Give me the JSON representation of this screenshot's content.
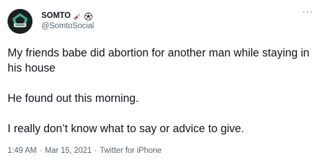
{
  "tweet": {
    "author": {
      "display_name": "SOMTO",
      "handle": "@SomtoSocial",
      "name_emojis": [
        "syringe-emoji",
        "soccer-ball-emoji"
      ]
    },
    "more_icon": "more-horizontal-icon",
    "body": [
      "My friends babe did abortion for another man while staying in his house",
      "He found out this morning.",
      "I really don’t know what to say or advice to give."
    ],
    "meta": {
      "time": "1:49 AM",
      "separator": "·",
      "date": "Mar 15, 2021",
      "source": "Twitter for iPhone"
    }
  },
  "colors": {
    "text_primary": "#0f1419",
    "text_secondary": "#536471",
    "avatar_bg": "#1a1f1f",
    "avatar_accent": "#3fbfa0"
  }
}
